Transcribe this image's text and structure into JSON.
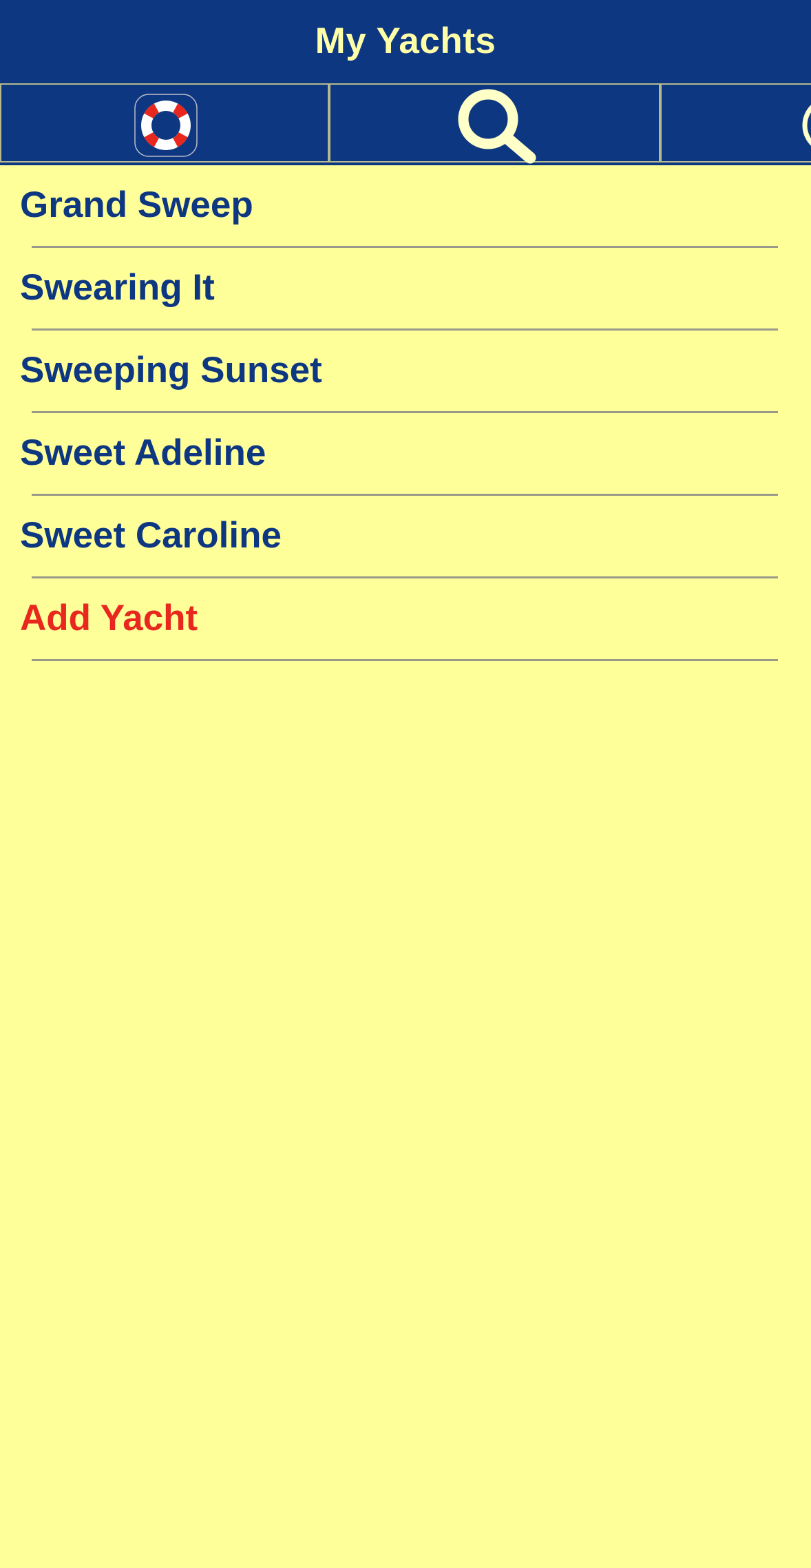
{
  "header": {
    "title": "My Yachts"
  },
  "toolbar": {
    "buttons": [
      {
        "icon": "life-ring-icon"
      },
      {
        "icon": "search-icon"
      },
      {
        "icon": "signal-icon"
      }
    ]
  },
  "yachts": {
    "items": [
      {
        "label": "Grand Sweep"
      },
      {
        "label": "Swearing It"
      },
      {
        "label": "Sweeping Sunset"
      },
      {
        "label": "Sweet Adeline"
      },
      {
        "label": "Sweet Caroline"
      }
    ],
    "add_label": "Add Yacht"
  },
  "colors": {
    "navy": "#0E3782",
    "background": "#FFFF99",
    "title_text": "#FFFFA8",
    "add_accent": "#E8281E",
    "divider": "#9A9A8A"
  }
}
